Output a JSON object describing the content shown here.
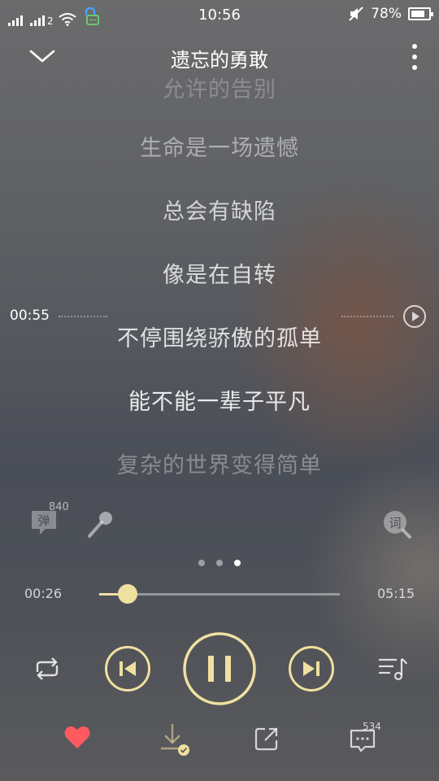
{
  "status_bar": {
    "sim1_label": "",
    "sim2_label": "2",
    "time": "10:56",
    "battery": "78%",
    "battery_level": 0.78,
    "icons": [
      "signal-icon",
      "signal-icon",
      "wifi-icon",
      "vpn-lock-icon",
      "mute-icon",
      "battery-icon"
    ]
  },
  "header": {
    "title": "遗忘的勇敢",
    "back_icon": "chevron-down-icon",
    "more_icon": "more-vertical-icon"
  },
  "lyrics": {
    "lines": [
      "允许的告别",
      "生命是一场遗憾",
      "总会有缺陷",
      "像是在自转",
      "不停围绕骄傲的孤单",
      "能不能一辈子平凡",
      "复杂的世界变得简单"
    ],
    "seek_time": "00:55"
  },
  "tools": {
    "danmu_label": "弹",
    "danmu_count": "840",
    "lyric_search_label": "词"
  },
  "pager": {
    "pages": 3,
    "active": 2
  },
  "progress": {
    "current": "00:26",
    "total": "05:15",
    "fraction": 0.118
  },
  "controls": {
    "loop_icon": "repeat-icon",
    "prev_icon": "skip-previous-icon",
    "pause_icon": "pause-icon",
    "next_icon": "skip-next-icon",
    "queue_icon": "playlist-icon"
  },
  "bottom_bar": {
    "comment_count": "534"
  },
  "colors": {
    "accent": "#efe0a0",
    "heart": "#ff5a5f"
  }
}
